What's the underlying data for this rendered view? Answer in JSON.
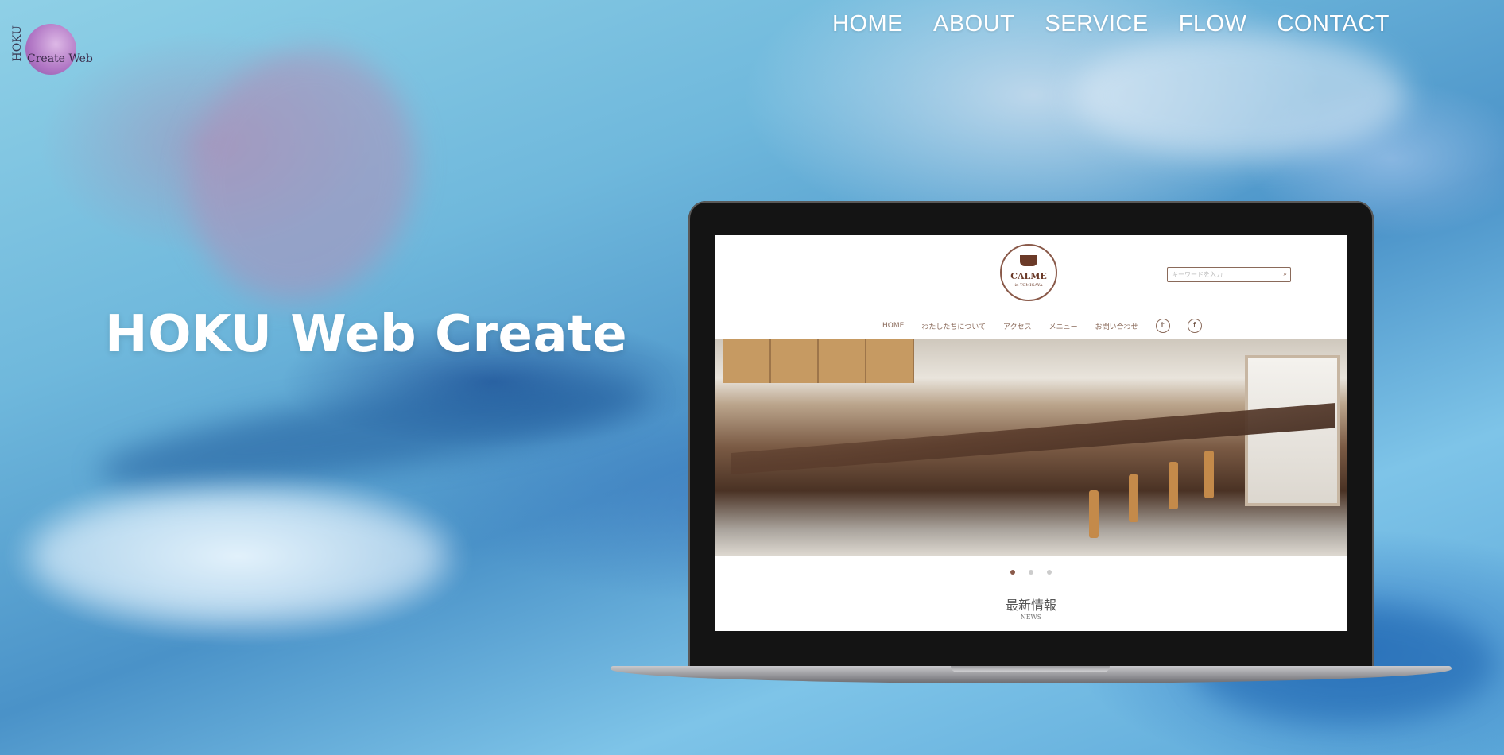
{
  "logo": {
    "vertical_text": "HOKU",
    "text": "Create Web"
  },
  "nav": {
    "items": [
      "HOME",
      "ABOUT",
      "SERVICE",
      "FLOW",
      "CONTACT"
    ]
  },
  "hero": {
    "title": "HOKU Web Create"
  },
  "mockup_site": {
    "logo_name": "CALME",
    "logo_sub": "in TOMIGAYA",
    "search_placeholder": "キーワードを入力",
    "nav": [
      "HOME",
      "わたしたちについて",
      "アクセス",
      "メニュー",
      "お問い合わせ"
    ],
    "social": [
      "twitter-icon",
      "facebook-icon"
    ],
    "social_glyphs": [
      "𝕥",
      "f"
    ],
    "slider_dots": 3,
    "news_title": "最新情報",
    "news_sub": "NEWS"
  },
  "colors": {
    "nav_text": "#ffffff",
    "accent_brown": "#6b3a28",
    "logo_purple": "#b46bc0"
  }
}
